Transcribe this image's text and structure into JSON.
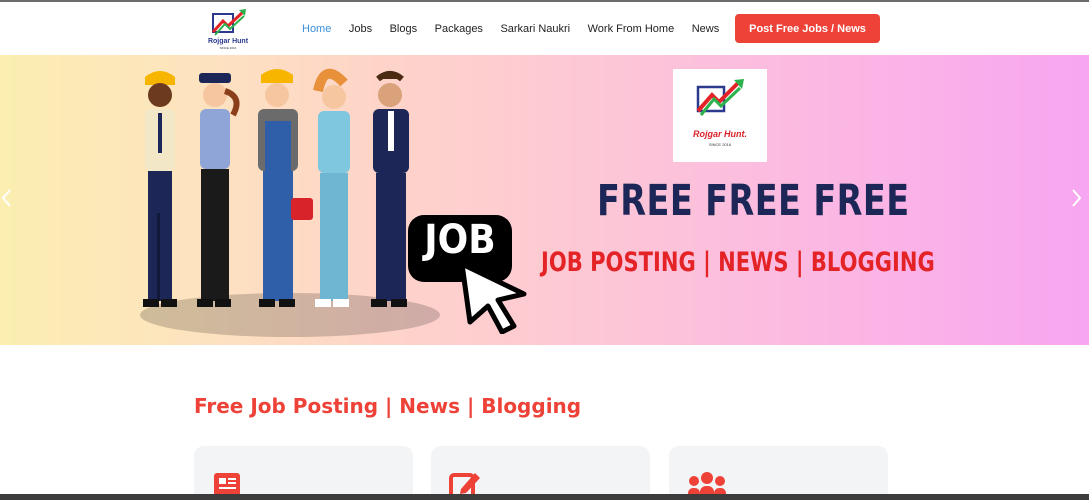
{
  "header": {
    "logo": {
      "brand": "Rojgar Hunt",
      "since": "SINCE 2016"
    },
    "nav": [
      {
        "label": "Home",
        "active": true
      },
      {
        "label": "Jobs",
        "active": false
      },
      {
        "label": "Blogs",
        "active": false
      },
      {
        "label": "Packages",
        "active": false
      },
      {
        "label": "Sarkari Naukri",
        "active": false
      },
      {
        "label": "Work From Home",
        "active": false
      },
      {
        "label": "News",
        "active": false
      }
    ],
    "cta_label": "Post Free Jobs / News"
  },
  "hero": {
    "logo_brand": "Rojgar Hunt.",
    "logo_since": "SINCE 2016",
    "headline": "FREE FREE FREE",
    "subline": "JOB POSTING | NEWS | BLOGGING",
    "badge_text": "JOB",
    "prev_icon": "chevron-left-icon",
    "next_icon": "chevron-right-icon"
  },
  "section": {
    "title": "Free Job Posting | News | Blogging",
    "cards": [
      {
        "icon": "newspaper-icon"
      },
      {
        "icon": "edit-icon"
      },
      {
        "icon": "users-icon"
      }
    ]
  },
  "colors": {
    "accent": "#ee4137",
    "nav_active": "#3b8fd9",
    "headline": "#1d2757",
    "card_bg": "#f3f4f6"
  }
}
